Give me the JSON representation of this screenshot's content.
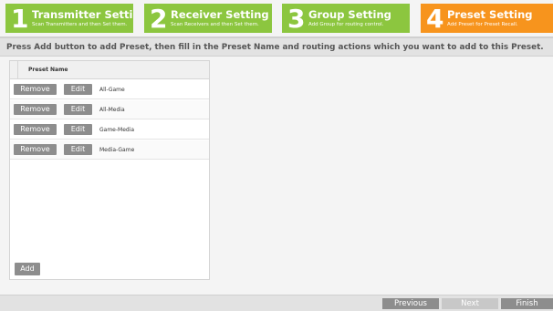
{
  "steps": [
    {
      "num": "1",
      "title": "Transmitter Setting",
      "desc": "Scan Transmitters and then Set them.",
      "color": "#8cc63f"
    },
    {
      "num": "2",
      "title": "Receiver Setting",
      "desc": "Scan Receivers and then Set them.",
      "color": "#8cc63f"
    },
    {
      "num": "3",
      "title": "Group Setting",
      "desc": "Add Group for routing control.",
      "color": "#8cc63f"
    },
    {
      "num": "4",
      "title": "Preset Setting",
      "desc": "Add Preset for Preset Recall.",
      "color": "#f7941d"
    }
  ],
  "instruction": "Press Add button to add Preset, then fill in the Preset Name and routing actions which you want to add to this Preset.",
  "table": {
    "header": "Preset Name",
    "remove_label": "Remove",
    "edit_label": "Edit",
    "rows": [
      "All-Game",
      "All-Media",
      "Game-Media",
      "Media-Game"
    ]
  },
  "add_label": "Add",
  "footer": {
    "previous_label": "Previous",
    "next_label": "Next",
    "finish_label": "Finish"
  }
}
